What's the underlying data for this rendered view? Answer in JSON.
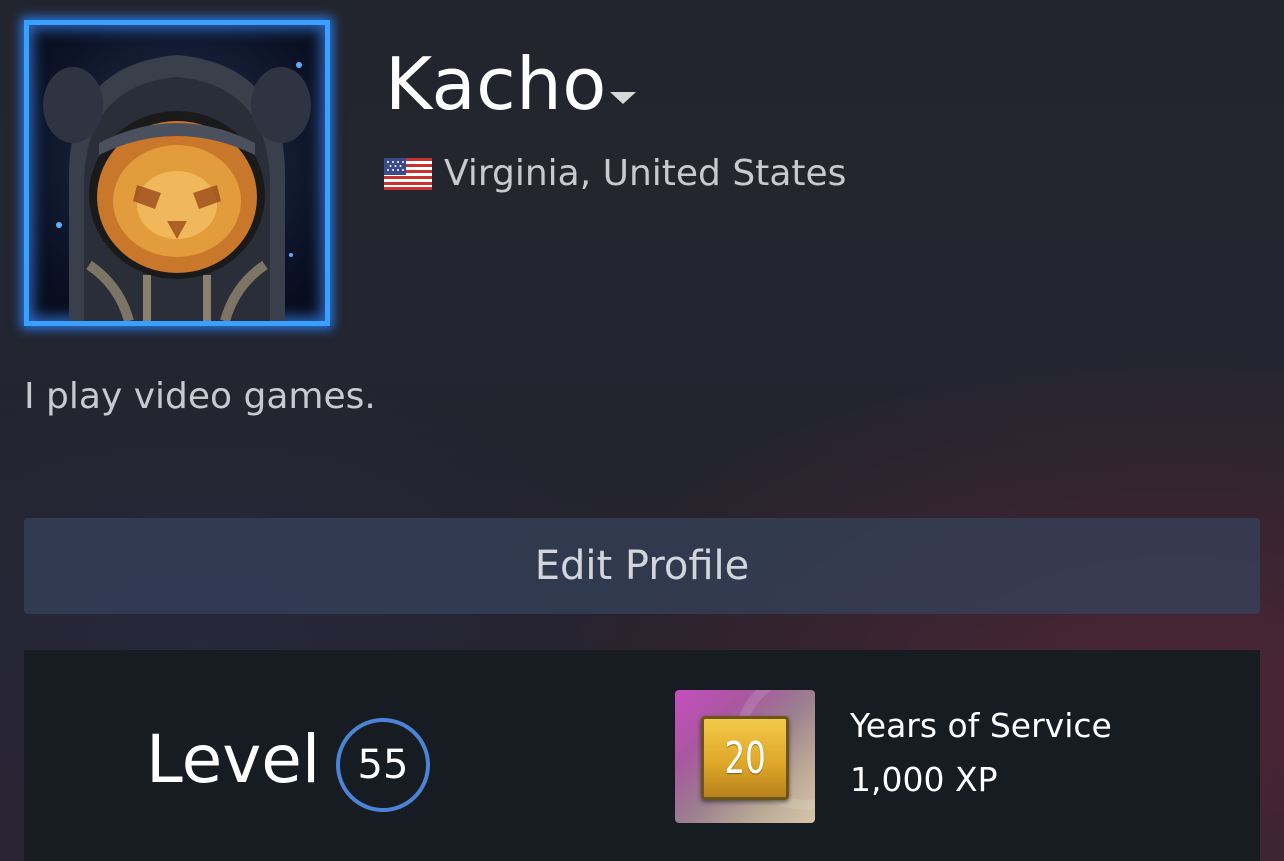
{
  "profile": {
    "username": "Kacho",
    "location": "Virginia, United States",
    "country_flag_icon": "us-flag-icon",
    "summary": "I play video games.",
    "avatar_border_color": "#3aa0ff"
  },
  "actions": {
    "edit_profile_label": "Edit Profile"
  },
  "level": {
    "label": "Level",
    "value": "55",
    "ring_color": "#4b84d6"
  },
  "badge": {
    "number": "20",
    "title": "Years of Service",
    "xp": "1,000 XP"
  }
}
